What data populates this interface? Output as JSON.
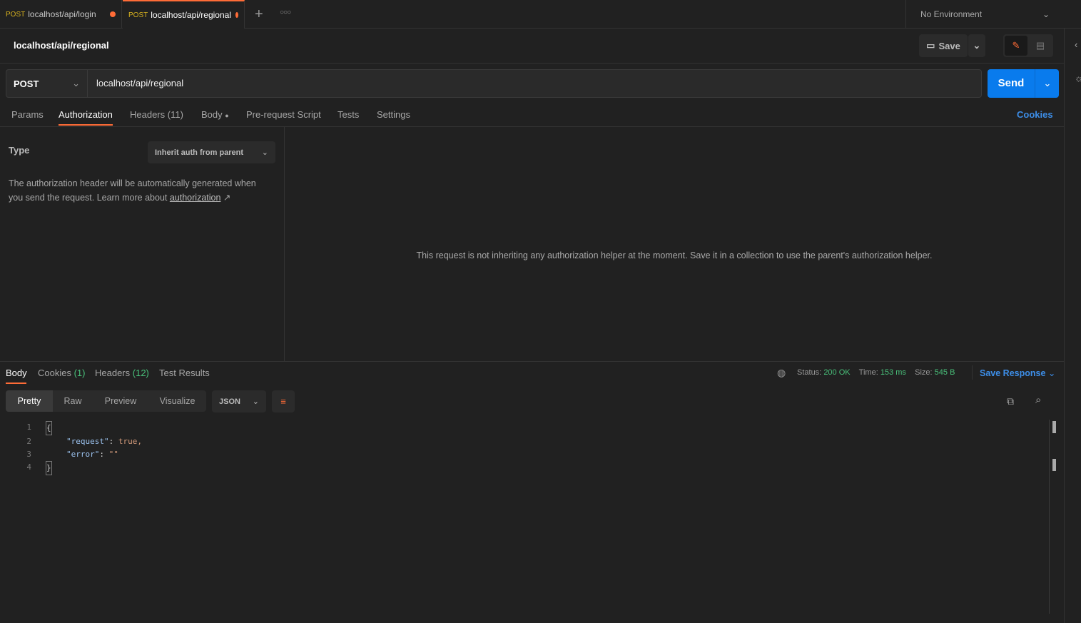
{
  "tabs": [
    {
      "method": "POST",
      "label": "localhost/api/login",
      "unsaved": true
    },
    {
      "method": "POST",
      "label": "localhost/api/regional",
      "unsaved": true,
      "active": true
    }
  ],
  "environment": "No Environment",
  "request": {
    "title": "localhost/api/regional",
    "method": "POST",
    "url": "localhost/api/regional",
    "save": "Save",
    "send": "Send"
  },
  "req_tabs": {
    "params": "Params",
    "authorization": "Authorization",
    "headers": "Headers",
    "headers_count": "(11)",
    "body": "Body",
    "prerequest": "Pre-request Script",
    "tests": "Tests",
    "settings": "Settings",
    "cookies": "Cookies"
  },
  "auth": {
    "type_label": "Type",
    "type_value": "Inherit auth from parent",
    "desc": "The authorization header will be automatically generated when you send the request. Learn more about ",
    "link": "authorization",
    "message": "This request is not inheriting any authorization helper at the moment. Save it in a collection to use the parent's authorization helper."
  },
  "response": {
    "tabs": {
      "body": "Body",
      "cookies": "Cookies",
      "cookies_count": "(1)",
      "headers": "Headers",
      "headers_count": "(12)",
      "tests": "Test Results"
    },
    "status_label": "Status:",
    "status": "200 OK",
    "time_label": "Time:",
    "time": "153 ms",
    "size_label": "Size:",
    "size": "545 B",
    "save": "Save Response",
    "views": [
      "Pretty",
      "Raw",
      "Preview",
      "Visualize"
    ],
    "format": "JSON",
    "lines": [
      {
        "n": "1",
        "t": "{"
      },
      {
        "n": "2",
        "k": "\"request\"",
        "v": "true,"
      },
      {
        "n": "3",
        "k": "\"error\"",
        "v": "\"\""
      },
      {
        "n": "4",
        "t": "}"
      }
    ]
  },
  "colors": {
    "accent": "#ff6c37",
    "send": "#097bed",
    "green": "#49c07a",
    "link": "#3d8ee8"
  }
}
